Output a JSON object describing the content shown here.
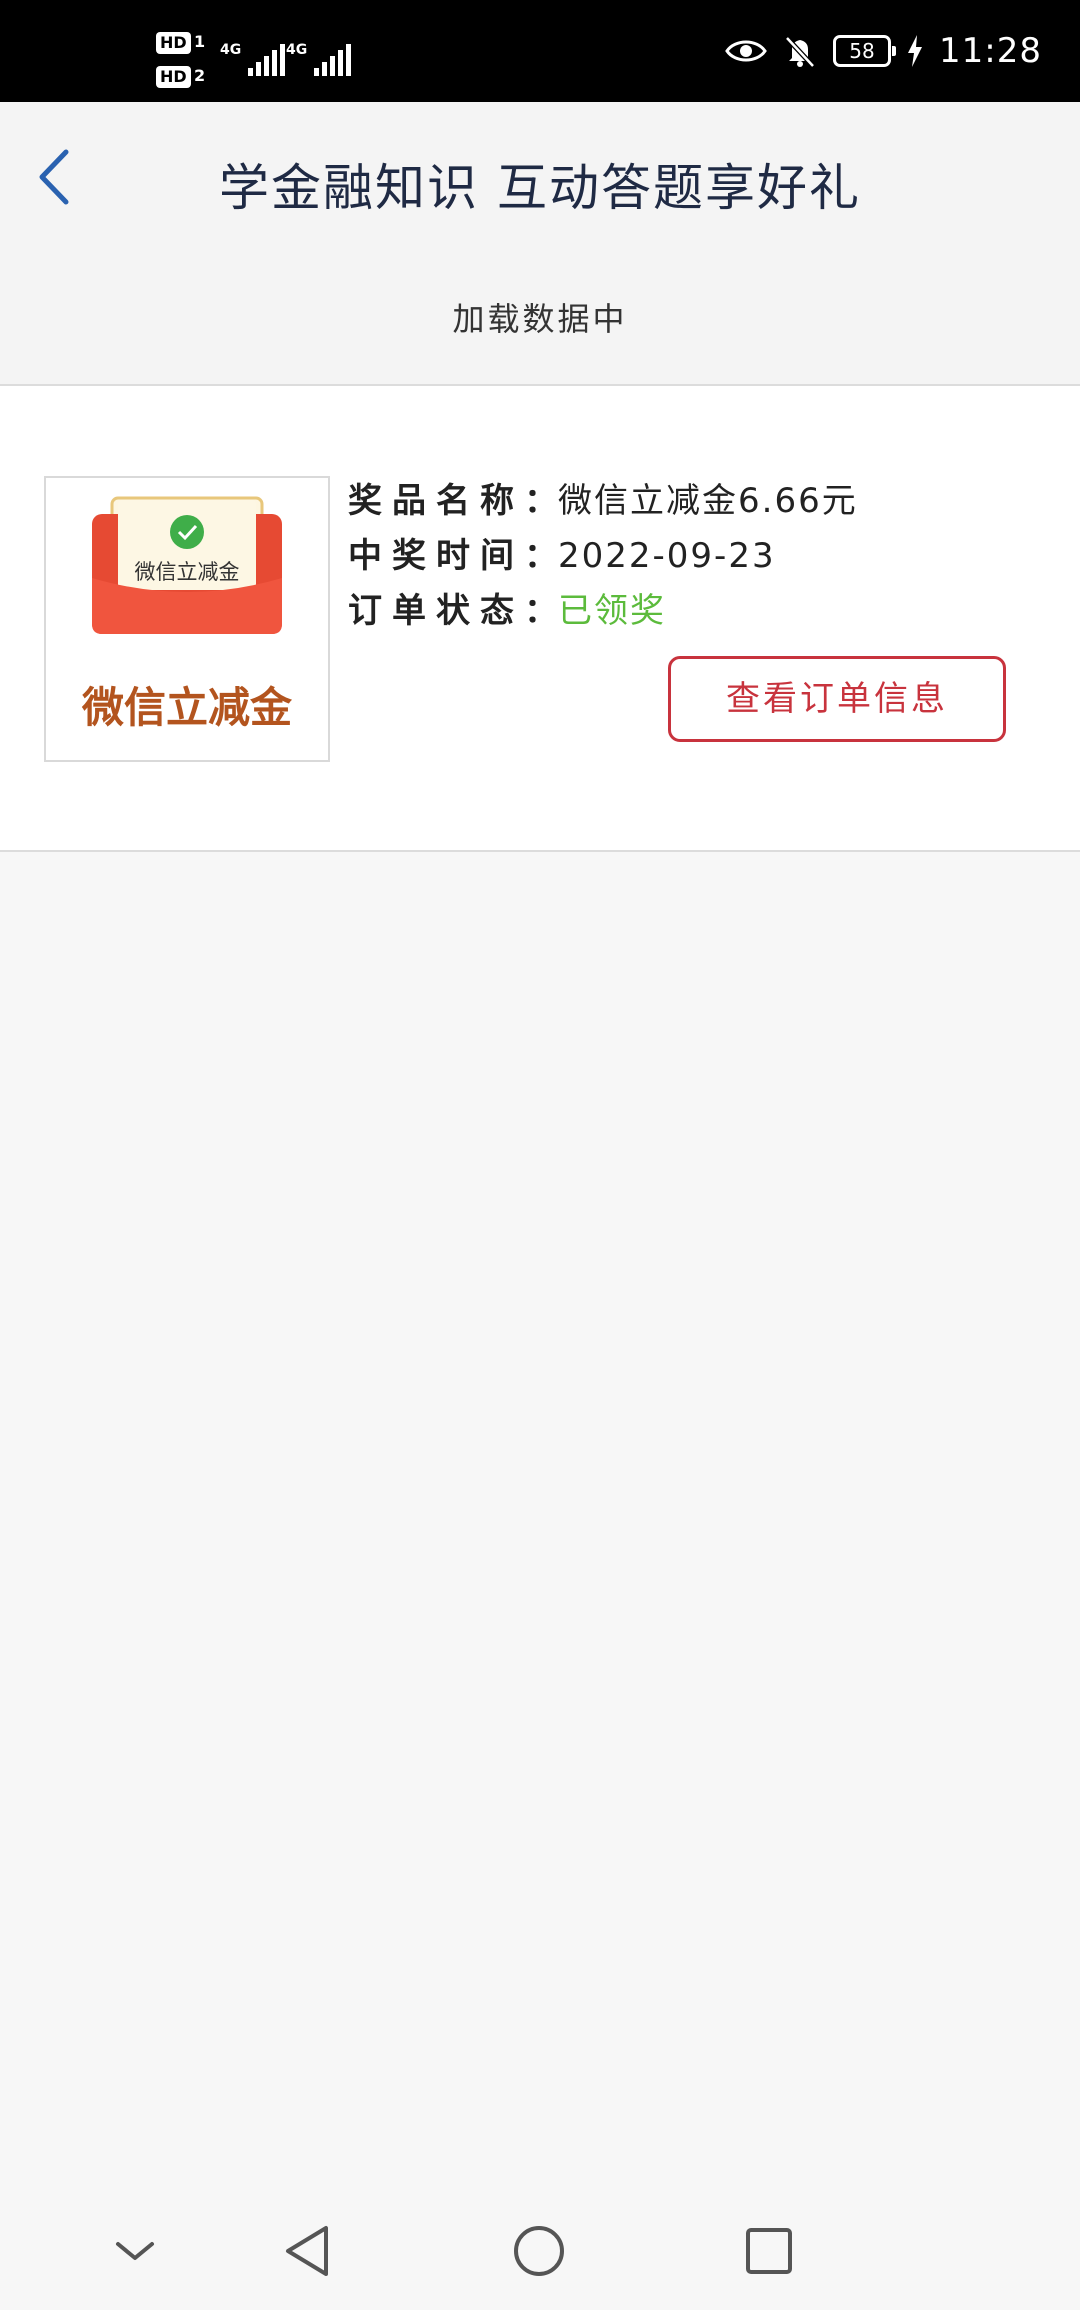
{
  "status_bar": {
    "sim1_badge": "HD",
    "sim1_num": "1",
    "sim2_badge": "HD",
    "sim2_num": "2",
    "network1": "4G",
    "network2": "4G",
    "battery": "58",
    "time": "11:28",
    "icons": [
      "eye-icon",
      "bell-off-icon",
      "battery-icon",
      "charging-icon"
    ]
  },
  "header": {
    "title": "学金融知识 互动答题享好礼",
    "back_icon": "chevron-left-icon"
  },
  "loading": {
    "text": "加载数据中"
  },
  "prize": {
    "image_envelope_text": "微信立减金",
    "image_caption": "微信立减金",
    "name_label": "奖品名称：",
    "name_value": "微信立减金6.66元",
    "time_label": "中奖时间：",
    "time_value": "2022-09-23",
    "status_label": "订单状态：",
    "status_value": "已领奖",
    "order_button": "查看订单信息",
    "colors": {
      "status": "#5cbb3c",
      "button": "#c8333d",
      "caption": "#b3541e"
    }
  },
  "system_nav": {
    "icons": [
      "chevron-down-icon",
      "back-triangle-icon",
      "home-circle-icon",
      "recent-square-icon"
    ]
  }
}
